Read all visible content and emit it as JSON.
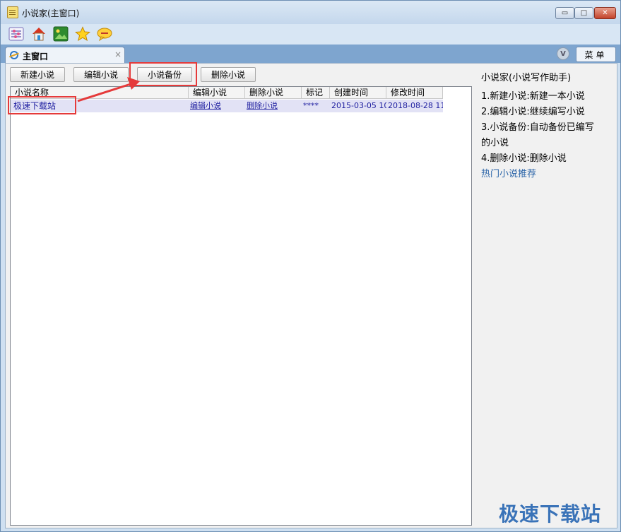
{
  "window": {
    "title": "小说家(主窗口)",
    "min_glyph": "▭",
    "max_glyph": "□",
    "close_glyph": "✕"
  },
  "toolbar": {
    "icons": [
      "list-settings-icon",
      "home-icon",
      "image-icon",
      "star-icon",
      "chat-bubble-icon"
    ]
  },
  "tabs": {
    "main_tab_label": "主窗口",
    "close_glyph": "×",
    "v_badge": "V",
    "menu_label": "菜单"
  },
  "actions": {
    "new_novel": "新建小说",
    "edit_novel": "编辑小说",
    "backup_novel": "小说备份",
    "delete_novel": "删除小说"
  },
  "grid": {
    "columns": [
      "小说名称",
      "编辑小说",
      "删除小说",
      "标记",
      "创建时间",
      "修改时间"
    ],
    "rows": [
      {
        "name": "极速下载站",
        "edit": "编辑小说",
        "delete": "删除小说",
        "mark": "****",
        "created": "2015-03-05 10",
        "modified": "2018-08-28 11"
      }
    ]
  },
  "help": {
    "title": "小说家(小说写作助手)",
    "items": [
      "1.新建小说:新建一本小说",
      "2.编辑小说:继续编写小说",
      "3.小说备份:自动备份已编写",
      "的小说",
      "4.删除小说:删除小说"
    ],
    "hot_link": "热门小说推荐"
  },
  "watermark": "极速下载站",
  "colors": {
    "accent": "#7ea5cf",
    "highlight_box": "#e53a3a",
    "row_selected": "#e2e2f5",
    "link": "#1f1fa0"
  }
}
